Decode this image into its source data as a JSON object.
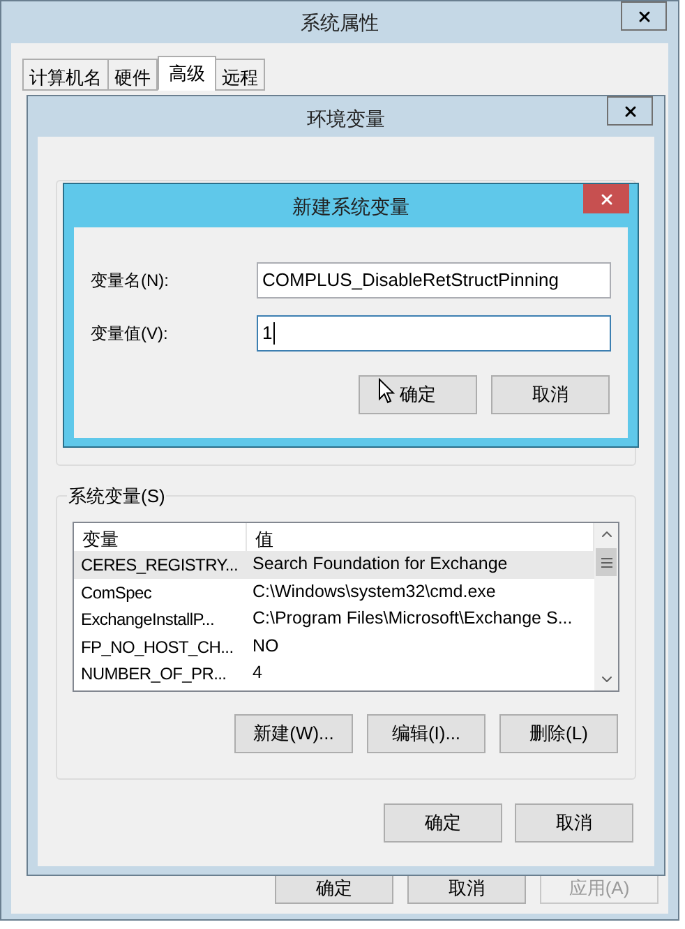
{
  "main_window": {
    "title": "系统属性",
    "tabs": [
      {
        "label": "计算机名",
        "selected": false
      },
      {
        "label": "硬件",
        "selected": false
      },
      {
        "label": "高级",
        "selected": true
      },
      {
        "label": "远程",
        "selected": false
      }
    ],
    "buttons": [
      {
        "label": "确定",
        "disabled": false
      },
      {
        "label": "取消",
        "disabled": false
      },
      {
        "label": "应用(A)",
        "disabled": true
      }
    ]
  },
  "env_window": {
    "title": "环境变量",
    "system_variables": {
      "label": "系统变量(S)",
      "columns": [
        "变量",
        "值"
      ],
      "rows": [
        {
          "name": "CERES_REGISTRY...",
          "value": "Search Foundation for Exchange",
          "selected": true
        },
        {
          "name": "ComSpec",
          "value": "C:\\Windows\\system32\\cmd.exe",
          "selected": false
        },
        {
          "name": "ExchangeInstallP...",
          "value": "C:\\Program Files\\Microsoft\\Exchange S...",
          "selected": false
        },
        {
          "name": "FP_NO_HOST_CH...",
          "value": "NO",
          "selected": false
        },
        {
          "name": "NUMBER_OF_PR...",
          "value": "4",
          "selected": false
        }
      ],
      "buttons": [
        "新建(W)...",
        "编辑(I)...",
        "删除(L)"
      ]
    },
    "buttons": [
      "确定",
      "取消"
    ]
  },
  "new_dialog": {
    "title": "新建系统变量",
    "fields": [
      {
        "label": "变量名(N):",
        "value": "COMPLUS_DisableRetStructPinning",
        "focused": false
      },
      {
        "label": "变量值(V):",
        "value": "1",
        "focused": true
      }
    ],
    "buttons": [
      "确定",
      "取消"
    ]
  }
}
